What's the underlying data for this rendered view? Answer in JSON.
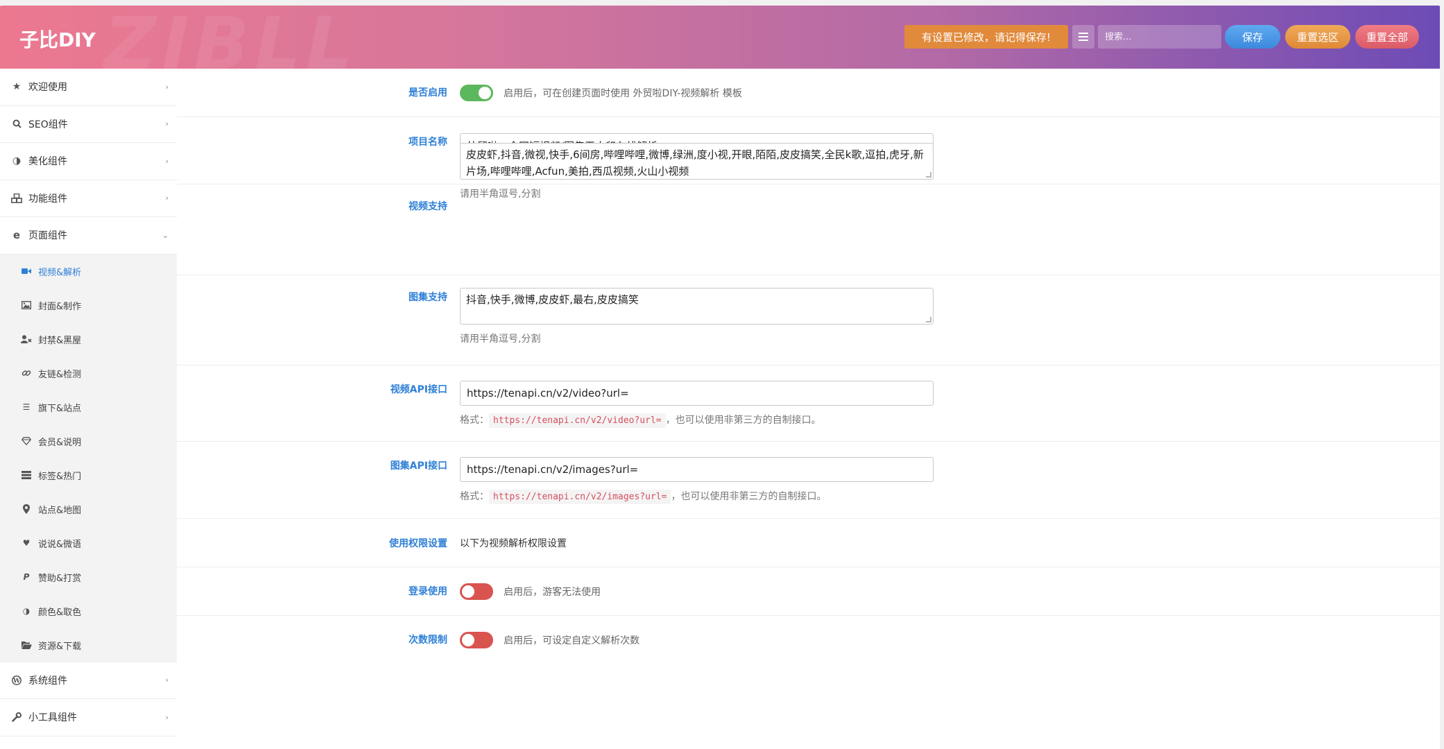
{
  "header": {
    "brand": "子比DIY",
    "watermark": "ZIBLL",
    "notice": "有设置已修改，请记得保存!",
    "search_placeholder": "搜索...",
    "save": "保存",
    "reset_section": "重置选区",
    "reset_all": "重置全部",
    "colors": {
      "gradient_start": "#ec7890",
      "gradient_end": "#6d4bb6",
      "notice": "#e18a3c",
      "save": "#3c89dd",
      "reset_section": "#df8936",
      "reset_all": "#da5b67"
    }
  },
  "sidebar": {
    "top_items": [
      {
        "label": "欢迎使用",
        "icon": "star-icon"
      },
      {
        "label": "SEO组件",
        "icon": "search-icon"
      },
      {
        "label": "美化组件",
        "icon": "half-circle-icon"
      },
      {
        "label": "功能组件",
        "icon": "cubes-icon"
      },
      {
        "label": "页面组件",
        "icon": "ie-icon",
        "expanded": true
      }
    ],
    "sub_items": [
      {
        "label": "视频&解析",
        "icon": "video-camera-icon",
        "active": true
      },
      {
        "label": "封面&制作",
        "icon": "image-icon"
      },
      {
        "label": "封禁&黑屋",
        "icon": "user-block-icon"
      },
      {
        "label": "友链&检测",
        "icon": "link-icon"
      },
      {
        "label": "旗下&站点",
        "icon": "list-icon"
      },
      {
        "label": "会员&说明",
        "icon": "diamond-icon"
      },
      {
        "label": "标签&热门",
        "icon": "tags-icon"
      },
      {
        "label": "站点&地图",
        "icon": "map-marker-icon"
      },
      {
        "label": "说说&微语",
        "icon": "heart-icon"
      },
      {
        "label": "赞助&打赏",
        "icon": "paypal-icon"
      },
      {
        "label": "颜色&取色",
        "icon": "contrast-icon"
      },
      {
        "label": "资源&下载",
        "icon": "folder-open-icon"
      }
    ],
    "bottom_items": [
      {
        "label": "系统组件",
        "icon": "wordpress-icon"
      },
      {
        "label": "小工具组件",
        "icon": "wrench-icon"
      }
    ]
  },
  "form": {
    "enable": {
      "label": "是否启用",
      "desc": "启用后，可在创建页面时使用 外贸啦DIY-视频解析 模板",
      "on": true
    },
    "project_name": {
      "label": "项目名称",
      "value": "外贸啦 - 全网短视频/图集无水印在线解析"
    },
    "video_support": {
      "label": "视频支持",
      "value": "皮皮虾,抖音,微视,快手,6间房,哔哩哔哩,微博,绿洲,度小视,开眼,陌陌,皮皮搞笑,全民k歌,逗拍,虎牙,新片场,哔哩哔哩,Acfun,美拍,西瓜视频,火山小视频",
      "hint": "请用半角逗号,分割"
    },
    "image_support": {
      "label": "图集支持",
      "value": "抖音,快手,微博,皮皮虾,最右,皮皮搞笑",
      "hint": "请用半角逗号,分割"
    },
    "video_api": {
      "label": "视频API接口",
      "value": "https://tenapi.cn/v2/video?url=",
      "hint_prefix": "格式：",
      "hint_code": "https://tenapi.cn/v2/video?url=",
      "hint_suffix": "，也可以使用非第三方的自制接口。"
    },
    "image_api": {
      "label": "图集API接口",
      "value": "https://tenapi.cn/v2/images?url=",
      "hint_prefix": "格式：",
      "hint_code": "https://tenapi.cn/v2/images?url=",
      "hint_suffix": "，也可以使用非第三方的自制接口。"
    },
    "permission": {
      "label": "使用权限设置",
      "text": "以下为视频解析权限设置"
    },
    "login_use": {
      "label": "登录使用",
      "desc": "启用后，游客无法使用",
      "on": false
    },
    "count_limit": {
      "label": "次数限制",
      "desc": "启用后，可设定自定义解析次数",
      "on": false
    }
  }
}
